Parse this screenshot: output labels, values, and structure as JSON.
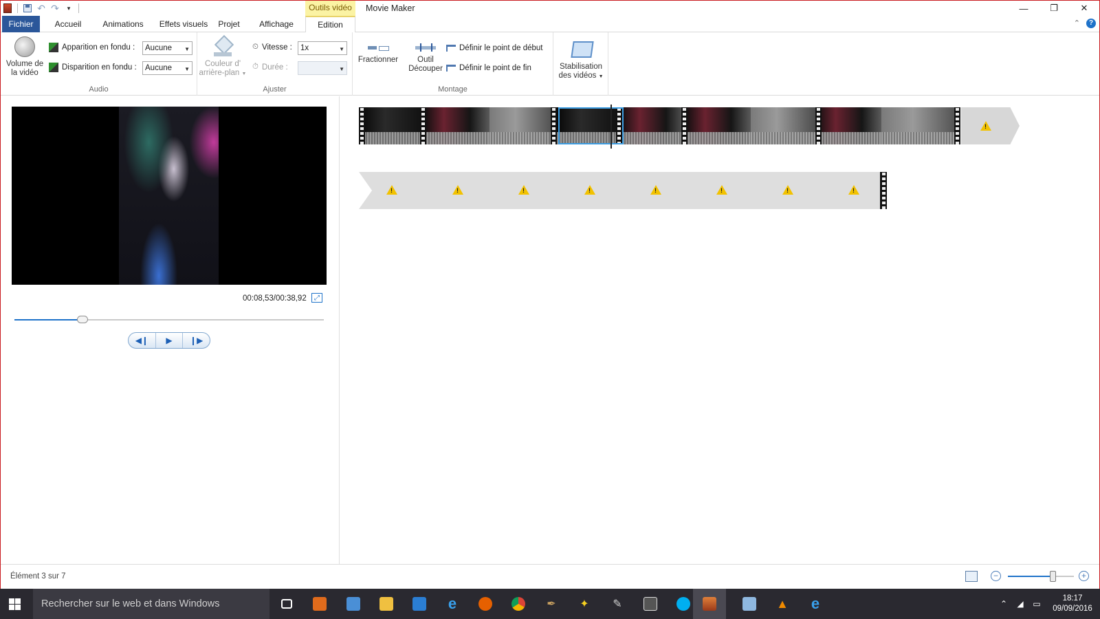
{
  "window": {
    "app_title": "Movie Maker",
    "context_tab_header": "Outils vidéo",
    "controls": {
      "minimize": "—",
      "restore": "❐",
      "close": "✕"
    }
  },
  "tabs": {
    "file": "Fichier",
    "home": "Accueil",
    "animations": "Animations",
    "visual_effects": "Effets visuels",
    "project": "Projet",
    "view": "Affichage",
    "edit": "Edition"
  },
  "ribbon": {
    "audio": {
      "label": "Audio",
      "volume_line1": "Volume de",
      "volume_line2": "la vidéo",
      "fade_in_label": "Apparition en fondu :",
      "fade_in_value": "Aucune",
      "fade_out_label": "Disparition en fondu :",
      "fade_out_value": "Aucune"
    },
    "adjust": {
      "label": "Ajuster",
      "bg_color_line1": "Couleur d'",
      "bg_color_line2": "arrière-plan",
      "speed_label": "Vitesse :",
      "speed_value": "1x",
      "duration_label": "Durée :",
      "duration_value": ""
    },
    "editing": {
      "label": "Montage",
      "split": "Fractionner",
      "trim_line1": "Outil",
      "trim_line2": "Découper",
      "set_start": "Définir le point de début",
      "set_end": "Définir le point de fin"
    },
    "stabilization": {
      "line1": "Stabilisation",
      "line2": "des vidéos"
    }
  },
  "preview": {
    "time": "00:08,53/00:38,92",
    "seek_fraction": 0.219
  },
  "status": {
    "item_text": "Élément 3 sur 7",
    "zoom_fraction": 0.69
  },
  "taskbar": {
    "search_placeholder": "Rechercher sur le web et dans Windows",
    "time": "18:17",
    "date": "09/09/2016"
  },
  "colors": {
    "accent": "#2b579a",
    "context_tab": "#fbf3a4",
    "selection": "#3c9de2",
    "warning": "#f2c200"
  }
}
